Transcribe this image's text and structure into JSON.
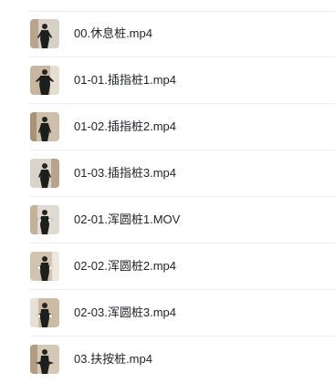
{
  "files": [
    {
      "name": "00.休息桩.mp4",
      "thumbnail": "video-thumbnail"
    },
    {
      "name": "01-01.插指桩1.mp4",
      "thumbnail": "video-thumbnail"
    },
    {
      "name": "01-02.插指桩2.mp4",
      "thumbnail": "video-thumbnail"
    },
    {
      "name": "01-03.插指桩3.mp4",
      "thumbnail": "video-thumbnail"
    },
    {
      "name": "02-01.浑圆桩1.MOV",
      "thumbnail": "video-thumbnail"
    },
    {
      "name": "02-02.浑圆桩2.mp4",
      "thumbnail": "video-thumbnail"
    },
    {
      "name": "02-03.浑圆桩3.mp4",
      "thumbnail": "video-thumbnail"
    },
    {
      "name": "03.扶按桩.mp4",
      "thumbnail": "video-thumbnail"
    }
  ],
  "colors": {
    "text": "#1f2329",
    "divider": "#efefef",
    "thumb_bg_light": "#d8d2c8",
    "thumb_bg_warm": "#c9b8a3",
    "figure": "#1c1f1c"
  }
}
